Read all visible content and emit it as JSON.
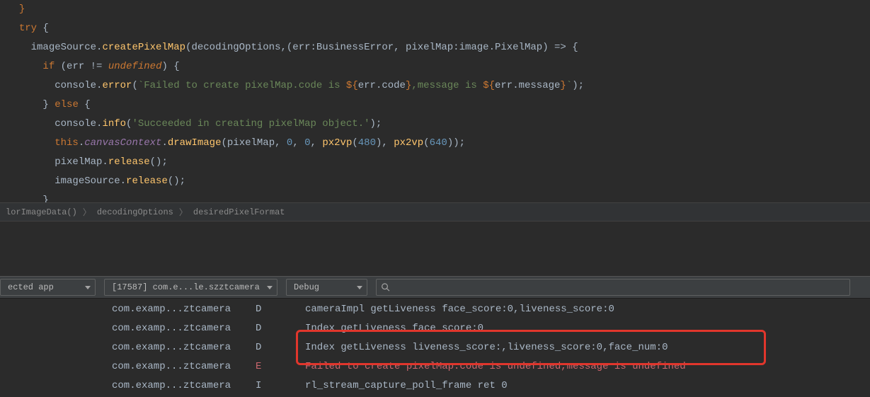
{
  "code": {
    "lines": [
      {
        "indent": "  ",
        "segs": [
          {
            "t": "}",
            "c": "b"
          }
        ]
      },
      {
        "indent": "  ",
        "segs": [
          {
            "t": "try",
            "c": "b"
          },
          {
            "t": " {",
            "c": "p"
          }
        ]
      },
      {
        "indent": "    ",
        "segs": [
          {
            "t": "imageSource.",
            "c": "id"
          },
          {
            "t": "createPixelMap",
            "c": "call"
          },
          {
            "t": "(decodingOptions,(",
            "c": "p"
          },
          {
            "t": "err:",
            "c": "id"
          },
          {
            "t": "BusinessError",
            "c": "ty"
          },
          {
            "t": ", ",
            "c": "p"
          },
          {
            "t": "pixelMap:",
            "c": "id"
          },
          {
            "t": "image.PixelMap",
            "c": "ty"
          },
          {
            "t": ") => {",
            "c": "p"
          }
        ]
      },
      {
        "indent": "      ",
        "segs": [
          {
            "t": "if",
            "c": "b"
          },
          {
            "t": " (err != ",
            "c": "p"
          },
          {
            "t": "undefined",
            "c": "kw"
          },
          {
            "t": ") {",
            "c": "p"
          }
        ]
      },
      {
        "indent": "        ",
        "segs": [
          {
            "t": "console.",
            "c": "id"
          },
          {
            "t": "error",
            "c": "call"
          },
          {
            "t": "(",
            "c": "p"
          },
          {
            "t": "`Failed to create pixelMap.code is ",
            "c": "tstr"
          },
          {
            "t": "${",
            "c": "b"
          },
          {
            "t": "err.code",
            "c": "id"
          },
          {
            "t": "}",
            "c": "b"
          },
          {
            "t": ",message is ",
            "c": "tstr"
          },
          {
            "t": "${",
            "c": "b"
          },
          {
            "t": "err.message",
            "c": "id"
          },
          {
            "t": "}",
            "c": "b"
          },
          {
            "t": "`",
            "c": "tstr"
          },
          {
            "t": ");",
            "c": "p"
          }
        ]
      },
      {
        "indent": "      ",
        "segs": [
          {
            "t": "} ",
            "c": "p"
          },
          {
            "t": "else",
            "c": "b"
          },
          {
            "t": " {",
            "c": "p"
          }
        ]
      },
      {
        "indent": "        ",
        "segs": [
          {
            "t": "console.",
            "c": "id"
          },
          {
            "t": "info",
            "c": "call"
          },
          {
            "t": "(",
            "c": "p"
          },
          {
            "t": "'Succeeded in creating pixelMap object.'",
            "c": "str"
          },
          {
            "t": ");",
            "c": "p"
          }
        ]
      },
      {
        "indent": "        ",
        "segs": [
          {
            "t": "this",
            "c": "b"
          },
          {
            "t": ".",
            "c": "p"
          },
          {
            "t": "canvasContext",
            "c": "prop"
          },
          {
            "t": ".",
            "c": "p"
          },
          {
            "t": "drawImage",
            "c": "call"
          },
          {
            "t": "(pixelMap, ",
            "c": "p"
          },
          {
            "t": "0",
            "c": "num"
          },
          {
            "t": ", ",
            "c": "p"
          },
          {
            "t": "0",
            "c": "num"
          },
          {
            "t": ", ",
            "c": "p"
          },
          {
            "t": "px2vp",
            "c": "call"
          },
          {
            "t": "(",
            "c": "p"
          },
          {
            "t": "480",
            "c": "num"
          },
          {
            "t": "), ",
            "c": "p"
          },
          {
            "t": "px2vp",
            "c": "call"
          },
          {
            "t": "(",
            "c": "p"
          },
          {
            "t": "640",
            "c": "num"
          },
          {
            "t": "));",
            "c": "p"
          }
        ]
      },
      {
        "indent": "        ",
        "segs": [
          {
            "t": "pixelMap.",
            "c": "id"
          },
          {
            "t": "release",
            "c": "call"
          },
          {
            "t": "();",
            "c": "p"
          }
        ]
      },
      {
        "indent": "        ",
        "segs": [
          {
            "t": "imageSource.",
            "c": "id"
          },
          {
            "t": "release",
            "c": "call"
          },
          {
            "t": "();",
            "c": "p"
          }
        ]
      },
      {
        "indent": "      ",
        "segs": [
          {
            "t": "}",
            "c": "p"
          }
        ]
      }
    ]
  },
  "breadcrumb": [
    "lorImageData()",
    "decodingOptions",
    "desiredPixelFormat"
  ],
  "toolbar": {
    "appFilter": "ected app",
    "processFilter": "[17587] com.e...le.szztcamera",
    "levelFilter": "Debug",
    "searchPlaceholder": ""
  },
  "logs": [
    {
      "tag": "com.examp...ztcamera",
      "lvl": "D",
      "msg": "cameraImpl getLiveness face_score:0,liveness_score:0",
      "cls": ""
    },
    {
      "tag": "com.examp...ztcamera",
      "lvl": "D",
      "msg": "Index getLiveness face_score:0",
      "cls": ""
    },
    {
      "tag": "com.examp...ztcamera",
      "lvl": "D",
      "msg": "Index getLiveness liveness_score:,liveness_score:0,face_num:0",
      "cls": ""
    },
    {
      "tag": "com.examp...ztcamera",
      "lvl": "E",
      "msg": "Failed to create pixelMap.code is undefined,message is undefined",
      "cls": "le"
    },
    {
      "tag": "com.examp...ztcamera",
      "lvl": "I",
      "msg": "rl_stream_capture_poll_frame ret 0",
      "cls": ""
    }
  ]
}
